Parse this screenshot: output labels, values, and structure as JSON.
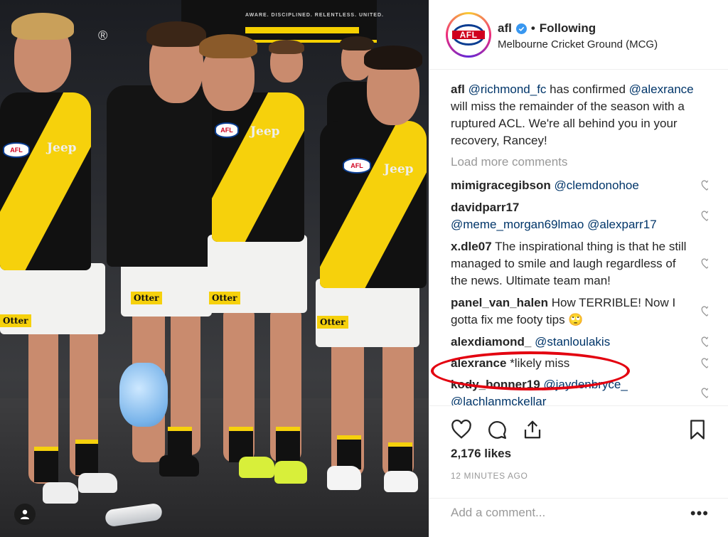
{
  "photo": {
    "banner_text": "AWARE. DISCIPLINED. RELENTLESS. UNITED.",
    "registered_mark": "®",
    "players": [
      {
        "jersey_sponsor": "Jeep",
        "shorts_sponsor": "Otter",
        "badge": "AFL"
      },
      {
        "jersey_sponsor": "",
        "shorts_sponsor": "Otter",
        "badge": ""
      },
      {
        "jersey_sponsor": "Jeep",
        "shorts_sponsor": "Otter",
        "badge": "AFL"
      },
      {
        "jersey_sponsor": "Jeep",
        "shorts_sponsor": "Otter",
        "badge": "AFL"
      }
    ],
    "colors": {
      "yellow": "#f6d10c",
      "black": "#111111"
    },
    "user_tag_icon": "user-icon"
  },
  "header": {
    "username": "afl",
    "verified_icon": "verified-badge-icon",
    "separator": "•",
    "follow_status": "Following",
    "location": "Melbourne Cricket Ground (MCG)",
    "avatar_text": "AFL"
  },
  "caption": {
    "username": "afl",
    "mention_1": "@richmond_fc",
    "text_1": " has confirmed ",
    "mention_2": "@alexrance",
    "text_2": " will miss the remainder of the season with a ruptured ACL. We're all behind you in your recovery, Rancey!"
  },
  "load_more": "Load more comments",
  "comments": [
    {
      "username": "mimigracegibson",
      "mention": "@clemdonohoe",
      "text": ""
    },
    {
      "username": "davidparr17",
      "mention": "@meme_morgan69lmao @alexparr17",
      "text": ""
    },
    {
      "username": "x.dle07",
      "mention": "",
      "text": "The inspirational thing is that he still managed to smile and laugh regardless of the news. Ultimate team man!"
    },
    {
      "username": "panel_van_halen",
      "mention": "",
      "text": "How TERRIBLE! Now I gotta fix me footy tips 🙄"
    },
    {
      "username": "alexdiamond_",
      "mention": "@stanloulakis",
      "text": ""
    },
    {
      "username": "alexrance",
      "mention": "",
      "text": "*likely miss"
    },
    {
      "username": "kody_bonner19",
      "mention": "@jaydenbryce_ @lachlanmckellar",
      "text": ""
    }
  ],
  "highlight_color": "#e3000f",
  "actions": {
    "like_icon": "heart-icon",
    "comment_icon": "comment-icon",
    "share_icon": "share-icon",
    "save_icon": "bookmark-icon"
  },
  "likes": "2,176 likes",
  "timestamp": "12 MINUTES AGO",
  "add_comment_placeholder": "Add a comment...",
  "more_options": "•••"
}
